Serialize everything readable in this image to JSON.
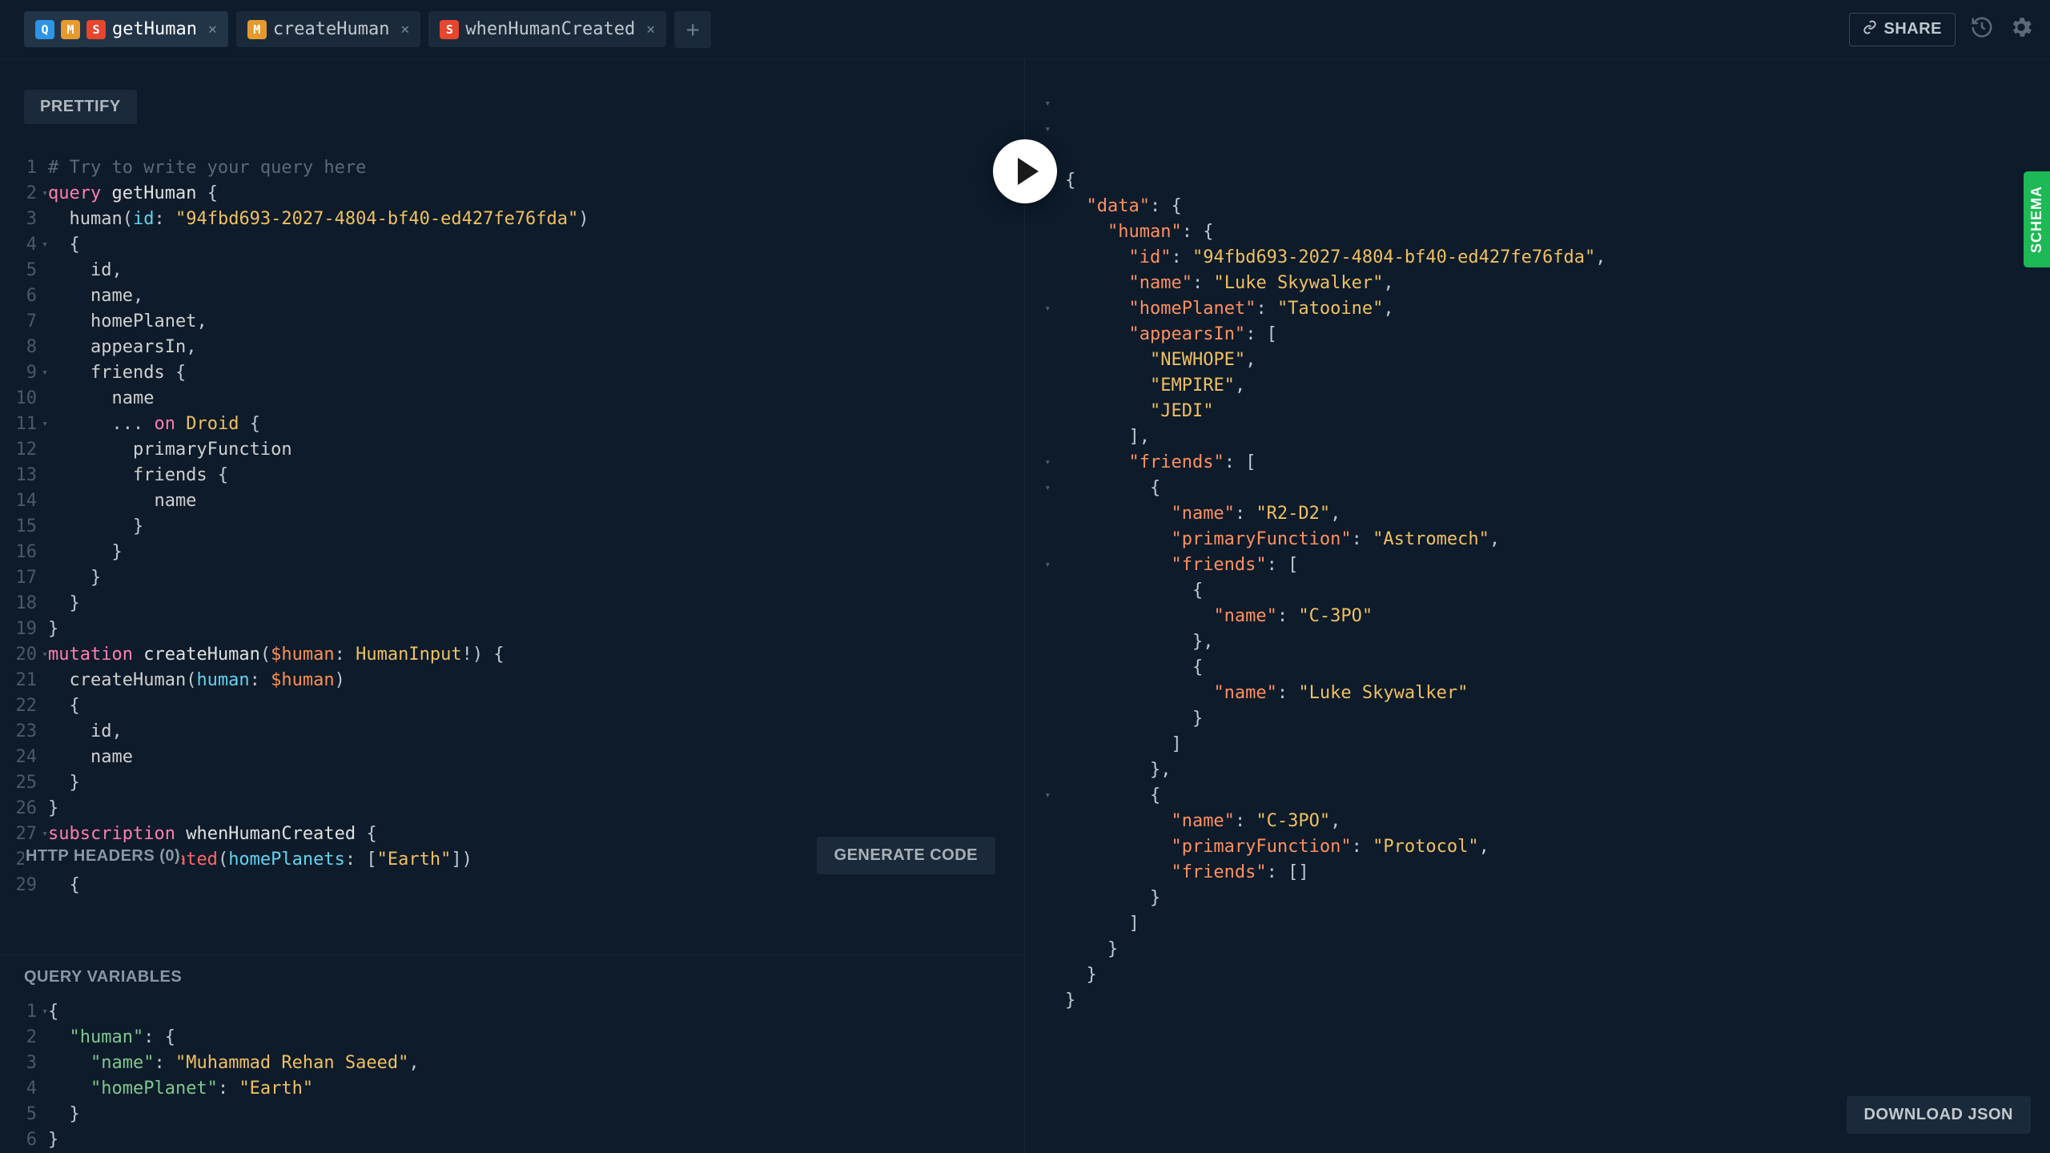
{
  "tabs": [
    {
      "badges": [
        "Q",
        "M",
        "S"
      ],
      "label": "getHuman",
      "active": true
    },
    {
      "badges": [
        "M"
      ],
      "label": "createHuman",
      "active": false
    },
    {
      "badges": [
        "S"
      ],
      "label": "whenHumanCreated",
      "active": false
    }
  ],
  "top": {
    "share": "SHARE"
  },
  "buttons": {
    "prettify": "PRETTIFY",
    "httpHeaders": "HTTP HEADERS (0)",
    "generateCode": "GENERATE CODE",
    "queryVariables": "QUERY VARIABLES",
    "downloadJson": "DOWNLOAD JSON",
    "schema": "SCHEMA"
  },
  "query": {
    "lines": [
      {
        "n": 1,
        "fold": false,
        "html": "<span class='c-comment'># Try to write your query here</span>"
      },
      {
        "n": 2,
        "fold": true,
        "html": "<span class='c-keyword'>query</span> <span class='c-def'>getHuman</span> <span class='c-punc'>{</span>"
      },
      {
        "n": 3,
        "fold": false,
        "html": "  human<span class='c-punc'>(</span><span class='c-attr'>id</span><span class='c-punc'>:</span> <span class='c-string'>\"94fbd693-2027-4804-bf40-ed427fe76fda\"</span><span class='c-punc'>)</span>"
      },
      {
        "n": 4,
        "fold": true,
        "html": "  <span class='c-punc'>{</span>"
      },
      {
        "n": 5,
        "fold": false,
        "html": "    id<span class='c-punc'>,</span>"
      },
      {
        "n": 6,
        "fold": false,
        "html": "    name<span class='c-punc'>,</span>"
      },
      {
        "n": 7,
        "fold": false,
        "html": "    homePlanet<span class='c-punc'>,</span>"
      },
      {
        "n": 8,
        "fold": false,
        "html": "    appearsIn<span class='c-punc'>,</span>"
      },
      {
        "n": 9,
        "fold": true,
        "html": "    friends <span class='c-punc'>{</span>"
      },
      {
        "n": 10,
        "fold": false,
        "html": "      name"
      },
      {
        "n": 11,
        "fold": true,
        "html": "      <span class='c-punc'>...</span> <span class='c-keyword'>on</span> <span class='c-type'>Droid</span> <span class='c-punc'>{</span>"
      },
      {
        "n": 12,
        "fold": false,
        "html": "        primaryFunction"
      },
      {
        "n": 13,
        "fold": false,
        "html": "        friends <span class='c-punc'>{</span>"
      },
      {
        "n": 14,
        "fold": false,
        "html": "          name"
      },
      {
        "n": 15,
        "fold": false,
        "html": "        <span class='c-punc'>}</span>"
      },
      {
        "n": 16,
        "fold": false,
        "html": "      <span class='c-punc'>}</span>"
      },
      {
        "n": 17,
        "fold": false,
        "html": "    <span class='c-punc'>}</span>"
      },
      {
        "n": 18,
        "fold": false,
        "html": "  <span class='c-punc'>}</span>"
      },
      {
        "n": 19,
        "fold": false,
        "html": "<span class='c-punc'>}</span>"
      },
      {
        "n": 20,
        "fold": true,
        "html": "<span class='c-keyword'>mutation</span> <span class='c-def'>createHuman</span><span class='c-punc'>(</span><span class='c-var'>$human</span><span class='c-punc'>:</span> <span class='c-type'>HumanInput</span><span class='c-punc'>!) {</span>"
      },
      {
        "n": 21,
        "fold": false,
        "html": "  createHuman<span class='c-punc'>(</span><span class='c-attr'>human</span><span class='c-punc'>:</span> <span class='c-var'>$human</span><span class='c-punc'>)</span>"
      },
      {
        "n": 22,
        "fold": false,
        "html": "  <span class='c-punc'>{</span>"
      },
      {
        "n": 23,
        "fold": false,
        "html": "    id<span class='c-punc'>,</span>"
      },
      {
        "n": 24,
        "fold": false,
        "html": "    name"
      },
      {
        "n": 25,
        "fold": false,
        "html": "  <span class='c-punc'>}</span>"
      },
      {
        "n": 26,
        "fold": false,
        "html": "<span class='c-punc'>}</span>"
      },
      {
        "n": 27,
        "fold": true,
        "html": "<span class='c-keyword'>subscription</span> <span class='c-def'>whenHumanCreated</span> <span class='c-punc'>{</span>"
      },
      {
        "n": 28,
        "fold": false,
        "html": "  <span class='c-red'>onHumanCreated</span><span class='c-punc'>(</span><span class='c-attr'>homePlanets</span><span class='c-punc'>:</span> <span class='c-punc'>[</span><span class='c-string'>\"Earth\"</span><span class='c-punc'>])</span>"
      },
      {
        "n": 29,
        "fold": false,
        "html": "  <span class='c-punc'>{</span>"
      }
    ]
  },
  "variables": {
    "lines": [
      {
        "n": 1,
        "fold": true,
        "html": "<span class='c-punc'>{</span>"
      },
      {
        "n": 2,
        "fold": false,
        "html": "  <span class='c-key'>\"human\"</span><span class='c-punc'>: {</span>"
      },
      {
        "n": 3,
        "fold": false,
        "html": "    <span class='c-key'>\"name\"</span><span class='c-punc'>:</span> <span class='c-string'>\"Muhammad Rehan Saeed\"</span><span class='c-punc'>,</span>"
      },
      {
        "n": 4,
        "fold": false,
        "html": "    <span class='c-key'>\"homePlanet\"</span><span class='c-punc'>:</span> <span class='c-string'>\"Earth\"</span>"
      },
      {
        "n": 5,
        "fold": false,
        "html": "  <span class='c-punc'>}</span>"
      },
      {
        "n": 6,
        "fold": false,
        "html": "<span class='c-punc'>}</span>"
      }
    ]
  },
  "response": {
    "foldRows": [
      0,
      1,
      2,
      8,
      14,
      15,
      18,
      27
    ],
    "lines": [
      "<span class='c-punc'>{</span>",
      "  <span class='c-res-key'>\"data\"</span><span class='c-punc'>: {</span>",
      "    <span class='c-res-key'>\"human\"</span><span class='c-punc'>: {</span>",
      "      <span class='c-res-key'>\"id\"</span><span class='c-punc'>:</span> <span class='c-string'>\"94fbd693-2027-4804-bf40-ed427fe76fda\"</span><span class='c-punc'>,</span>",
      "      <span class='c-res-key'>\"name\"</span><span class='c-punc'>:</span> <span class='c-string'>\"Luke Skywalker\"</span><span class='c-punc'>,</span>",
      "      <span class='c-res-key'>\"homePlanet\"</span><span class='c-punc'>:</span> <span class='c-string'>\"Tatooine\"</span><span class='c-punc'>,</span>",
      "      <span class='c-res-key'>\"appearsIn\"</span><span class='c-punc'>: [</span>",
      "        <span class='c-string'>\"NEWHOPE\"</span><span class='c-punc'>,</span>",
      "        <span class='c-string'>\"EMPIRE\"</span><span class='c-punc'>,</span>",
      "        <span class='c-string'>\"JEDI\"</span>",
      "      <span class='c-punc'>],</span>",
      "      <span class='c-res-key'>\"friends\"</span><span class='c-punc'>: [</span>",
      "        <span class='c-punc'>{</span>",
      "          <span class='c-res-key'>\"name\"</span><span class='c-punc'>:</span> <span class='c-string'>\"R2-D2\"</span><span class='c-punc'>,</span>",
      "          <span class='c-res-key'>\"primaryFunction\"</span><span class='c-punc'>:</span> <span class='c-string'>\"Astromech\"</span><span class='c-punc'>,</span>",
      "          <span class='c-res-key'>\"friends\"</span><span class='c-punc'>: [</span>",
      "            <span class='c-punc'>{</span>",
      "              <span class='c-res-key'>\"name\"</span><span class='c-punc'>:</span> <span class='c-string'>\"C-3PO\"</span>",
      "            <span class='c-punc'>},</span>",
      "            <span class='c-punc'>{</span>",
      "              <span class='c-res-key'>\"name\"</span><span class='c-punc'>:</span> <span class='c-string'>\"Luke Skywalker\"</span>",
      "            <span class='c-punc'>}</span>",
      "          <span class='c-punc'>]</span>",
      "        <span class='c-punc'>},</span>",
      "        <span class='c-punc'>{</span>",
      "          <span class='c-res-key'>\"name\"</span><span class='c-punc'>:</span> <span class='c-string'>\"C-3PO\"</span><span class='c-punc'>,</span>",
      "          <span class='c-res-key'>\"primaryFunction\"</span><span class='c-punc'>:</span> <span class='c-string'>\"Protocol\"</span><span class='c-punc'>,</span>",
      "          <span class='c-res-key'>\"friends\"</span><span class='c-punc'>: []</span>",
      "        <span class='c-punc'>}</span>",
      "      <span class='c-punc'>]</span>",
      "    <span class='c-punc'>}</span>",
      "  <span class='c-punc'>}</span>",
      "<span class='c-punc'>}</span>"
    ]
  }
}
